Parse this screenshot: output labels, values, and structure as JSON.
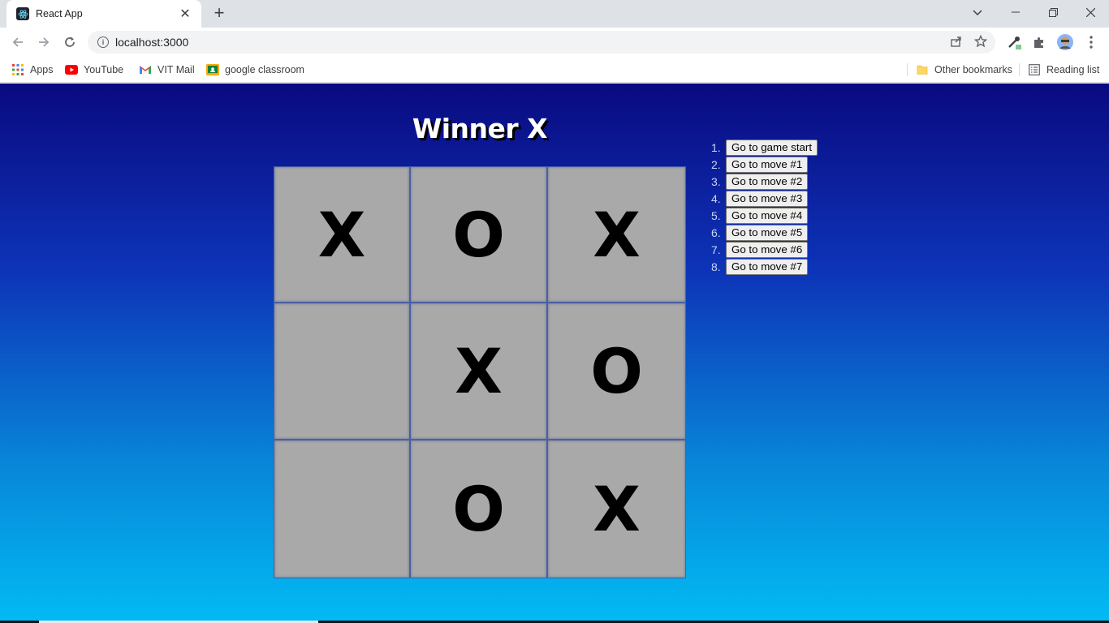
{
  "browser": {
    "tab_title": "React App",
    "new_tab_symbol": "+",
    "url": "localhost:3000",
    "bookmarks": [
      {
        "label": "Apps",
        "icon": "apps-grid-icon"
      },
      {
        "label": "YouTube",
        "icon": "youtube-icon"
      },
      {
        "label": "VIT Mail",
        "icon": "gmail-icon"
      },
      {
        "label": "google classroom",
        "icon": "classroom-icon"
      }
    ],
    "other_bookmarks": "Other bookmarks",
    "reading_list": "Reading list"
  },
  "game": {
    "status": "Winner X",
    "squares": [
      "X",
      "O",
      "X",
      "",
      "X",
      "O",
      "",
      "O",
      "X"
    ],
    "moves": [
      {
        "num": "1.",
        "label": "Go to game start"
      },
      {
        "num": "2.",
        "label": "Go to move #1"
      },
      {
        "num": "3.",
        "label": "Go to move #2"
      },
      {
        "num": "4.",
        "label": "Go to move #3"
      },
      {
        "num": "5.",
        "label": "Go to move #4"
      },
      {
        "num": "6.",
        "label": "Go to move #5"
      },
      {
        "num": "7.",
        "label": "Go to move #6"
      },
      {
        "num": "8.",
        "label": "Go to move #7"
      }
    ]
  },
  "colors": {
    "square_bg": "#a9a9a9",
    "gradient_top": "#0a0a80",
    "gradient_bottom": "#02bbf4"
  }
}
